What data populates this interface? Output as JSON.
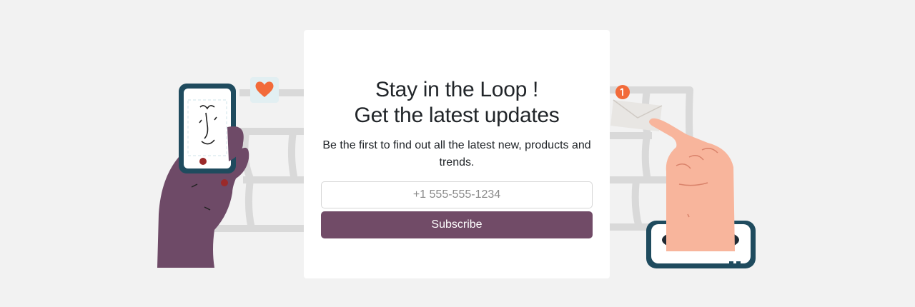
{
  "newsletter": {
    "title_line1": "Stay in the Loop !",
    "title_line2": "Get the latest updates",
    "subtitle": "Be the first to find out all the latest new, products and trends.",
    "phone_placeholder": "+1 555-555-1234",
    "phone_value": "",
    "subscribe_label": "Subscribe"
  },
  "decorations": {
    "left_illustration": "hand-holding-phone-illustration",
    "right_illustration": "hand-pointing-illustration",
    "icons": [
      "heart-icon",
      "envelope-icon",
      "notification-badge-icon"
    ]
  },
  "colors": {
    "accent": "#714b67",
    "heart": "#f26b3a",
    "background": "#f2f2f2"
  }
}
